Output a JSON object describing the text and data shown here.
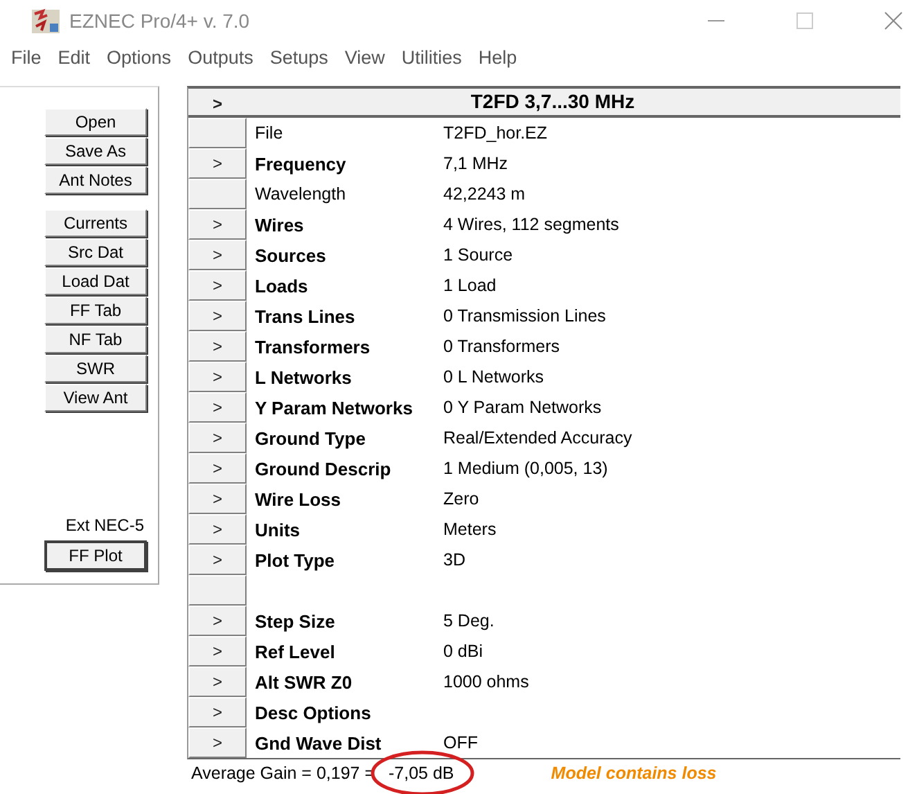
{
  "window": {
    "title": "EZNEC Pro/4+  v. 7.0"
  },
  "menu": [
    "File",
    "Edit",
    "Options",
    "Outputs",
    "Setups",
    "View",
    "Utilities",
    "Help"
  ],
  "side_buttons": [
    {
      "kind": "button",
      "label": "Open"
    },
    {
      "kind": "button",
      "label": "Save As"
    },
    {
      "kind": "button",
      "label": "Ant Notes"
    },
    {
      "kind": "gap"
    },
    {
      "kind": "button",
      "label": "Currents"
    },
    {
      "kind": "button",
      "label": "Src Dat"
    },
    {
      "kind": "button",
      "label": "Load Dat"
    },
    {
      "kind": "button",
      "label": "FF Tab"
    },
    {
      "kind": "button",
      "label": "NF Tab"
    },
    {
      "kind": "button",
      "label": "SWR"
    },
    {
      "kind": "button",
      "label": "View Ant"
    },
    {
      "kind": "spacer"
    },
    {
      "kind": "label",
      "label": "Ext NEC-5"
    },
    {
      "kind": "default",
      "label": "FF Plot"
    }
  ],
  "table": {
    "header_arrow": ">",
    "title": "T2FD 3,7...30 MHz",
    "rows": [
      {
        "kind": "info",
        "label": "File",
        "value": "T2FD_hor.EZ"
      },
      {
        "kind": "command",
        "arrow": ">",
        "label": "Frequency",
        "value": "7,1 MHz"
      },
      {
        "kind": "info",
        "label": "Wavelength",
        "value": "42,2243 m"
      },
      {
        "kind": "command",
        "arrow": ">",
        "label": "Wires",
        "value": "4 Wires, 112 segments"
      },
      {
        "kind": "command",
        "arrow": ">",
        "label": "Sources",
        "value": "1 Source"
      },
      {
        "kind": "command",
        "arrow": ">",
        "label": "Loads",
        "value": "1 Load"
      },
      {
        "kind": "command",
        "arrow": ">",
        "label": "Trans Lines",
        "value": "0 Transmission Lines"
      },
      {
        "kind": "command",
        "arrow": ">",
        "label": "Transformers",
        "value": "0 Transformers"
      },
      {
        "kind": "command",
        "arrow": ">",
        "label": "L Networks",
        "value": "0 L Networks"
      },
      {
        "kind": "command",
        "arrow": ">",
        "label": "Y Param Networks",
        "value": "0 Y Param Networks"
      },
      {
        "kind": "command",
        "arrow": ">",
        "label": "Ground Type",
        "value": "Real/Extended Accuracy"
      },
      {
        "kind": "command",
        "arrow": ">",
        "label": "Ground Descrip",
        "value": "1 Medium (0,005, 13)"
      },
      {
        "kind": "command",
        "arrow": ">",
        "label": "Wire Loss",
        "value": "Zero"
      },
      {
        "kind": "command",
        "arrow": ">",
        "label": "Units",
        "value": "Meters"
      },
      {
        "kind": "command",
        "arrow": ">",
        "label": "Plot Type",
        "value": "3D"
      },
      {
        "kind": "blank"
      },
      {
        "kind": "command",
        "arrow": ">",
        "label": "Step Size",
        "value": "5 Deg."
      },
      {
        "kind": "command",
        "arrow": ">",
        "label": "Ref Level",
        "value": "0 dBi"
      },
      {
        "kind": "command",
        "arrow": ">",
        "label": "Alt SWR Z0",
        "value": "1000 ohms"
      },
      {
        "kind": "command",
        "arrow": ">",
        "label": "Desc Options"
      },
      {
        "kind": "command",
        "arrow": ">",
        "label": "Gnd Wave Dist",
        "value": "OFF"
      }
    ]
  },
  "status": {
    "gain_prefix": "Average Gain = 0,197 =",
    "gain_db": "-7,05 dB",
    "warning": "Model contains loss"
  }
}
